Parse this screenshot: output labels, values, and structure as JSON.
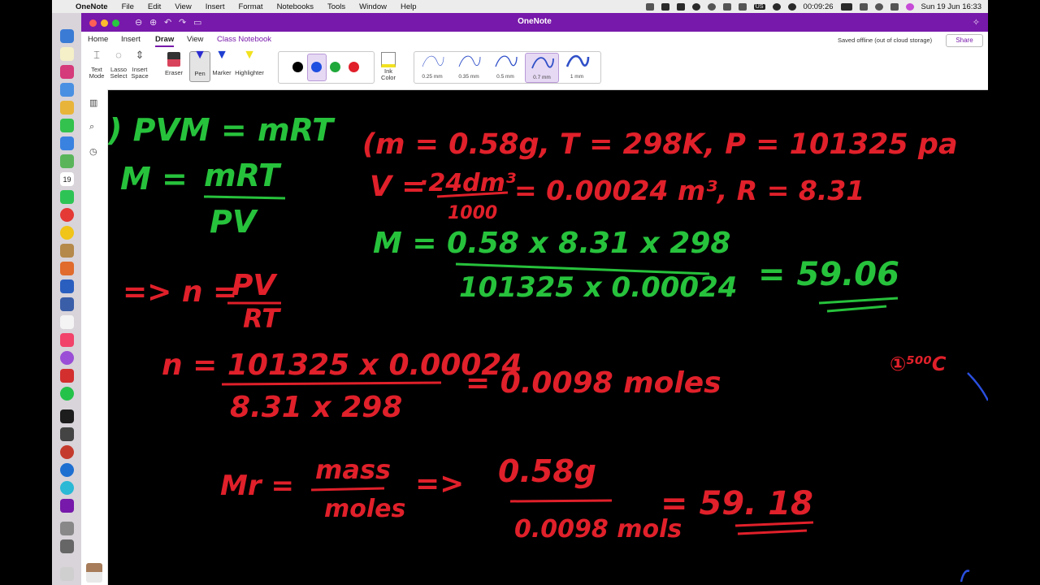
{
  "menubar": {
    "app_name": "OneNote",
    "items": [
      "File",
      "Edit",
      "View",
      "Insert",
      "Format",
      "Notebooks",
      "Tools",
      "Window",
      "Help"
    ],
    "timer": "00:09:26",
    "keyboard": "US",
    "datetime": "Sun 19 Jun  16:33"
  },
  "window": {
    "title": "OneNote",
    "status": "Saved offline (out of cloud storage)",
    "share": "Share"
  },
  "ribbon": {
    "tabs": [
      "Home",
      "Insert",
      "Draw",
      "View",
      "Class Notebook"
    ],
    "tools": {
      "text_mode": "Text\nMode",
      "lasso_select": "Lasso\nSelect",
      "insert_space": "Insert\nSpace",
      "eraser": "Eraser",
      "pen": "Pen",
      "marker": "Marker",
      "highlighter": "Highlighter",
      "ink_color": "Ink\nColor"
    },
    "colors": [
      "#000000",
      "#1f4fe0",
      "#1fa83a",
      "#e0202a"
    ],
    "pen_sizes": [
      "0.25 mm",
      "0.35 mm",
      "0.5 mm",
      "0.7 mm",
      "1 mm"
    ]
  },
  "dock": {
    "calendar_day": "19"
  },
  "note": {
    "lines": {
      "pvm": ") PVM = mRT",
      "m_eq": "M =",
      "m_num": "mRT",
      "m_den": "PV",
      "given1": "(m = 0.58g,  T = 298K,  P = 101325 pa",
      "given2a": "V =",
      "given2b": "·24dm³",
      "given2c": "1000",
      "given2d": "= 0.00024 m³,  R = 8.31",
      "calc_m": "M = 0.58 x 8.31 x 298",
      "calc_den": "101325 x 0.00024",
      "result1": "= 59.06",
      "n_arrow": "=> n =",
      "n_num": "PV",
      "n_den": "RT",
      "n_eq": "n = 101325 x 0.00024",
      "n_den2": "8.31 x 298",
      "n_result": "= 0.0098 moles",
      "mr": "Mr =",
      "mr_num": "mass",
      "mr_den": "moles",
      "mr_arrow": "=>",
      "mr_val_num": "0.58g",
      "mr_val_den": "0.0098 mols",
      "result2": "= 59. 18",
      "margin_note": "①⁵⁰⁰C"
    }
  }
}
